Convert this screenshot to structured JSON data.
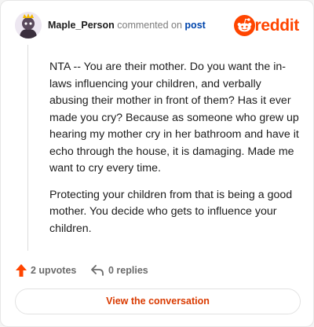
{
  "author": {
    "username": "Maple_Person",
    "action": "commented on",
    "target": "post"
  },
  "brand": {
    "name": "reddit",
    "color": "#ff4500"
  },
  "comment": {
    "paragraphs": [
      "NTA -- You are their mother. Do you want the in-laws influencing your children, and verbally abusing their mother in front of them? Has it ever made you cry? Because as someone who grew up hearing my mother cry in her bathroom and have it echo through the house, it is damaging. Made me want to cry every time.",
      "Protecting your children from that is being a good mother. You decide who gets to influence your children."
    ]
  },
  "stats": {
    "upvotes": "2 upvotes",
    "replies": "0 replies"
  },
  "cta": {
    "label": "View the conversation"
  },
  "icons": {
    "upvote": "upvote-arrow-icon",
    "reply": "reply-arrow-icon",
    "logo": "reddit-snoo-icon",
    "avatar": "avatar"
  },
  "colors": {
    "accent": "#ff4500",
    "link": "#0045ac",
    "cta": "#d93a00"
  }
}
